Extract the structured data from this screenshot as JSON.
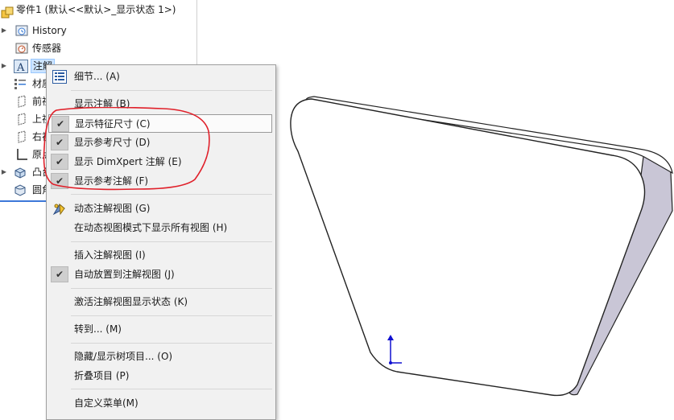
{
  "tree": {
    "root_label": "零件1 (默认<<默认>_显示状态 1>)",
    "items": [
      {
        "label": "History",
        "icon": "history-icon",
        "expandable": true
      },
      {
        "label": "传感器",
        "icon": "sensor-icon",
        "expandable": false
      },
      {
        "label": "注解",
        "icon": "annotation-icon",
        "expandable": true,
        "selected": true
      },
      {
        "label": "材质",
        "icon": "material-icon",
        "expandable": false
      },
      {
        "label": "前视",
        "icon": "plane-icon",
        "expandable": false
      },
      {
        "label": "上视",
        "icon": "plane-icon",
        "expandable": false
      },
      {
        "label": "右视",
        "icon": "plane-icon",
        "expandable": false
      },
      {
        "label": "原点",
        "icon": "origin-icon",
        "expandable": false
      },
      {
        "label": "凸台",
        "icon": "boss-extrude-icon",
        "expandable": true
      },
      {
        "label": "圆角",
        "icon": "fillet-icon",
        "expandable": false
      }
    ]
  },
  "menu": {
    "items": [
      {
        "label": "细节... (A)",
        "icon": "details-icon",
        "checked": false
      },
      {
        "label": "显示注解 (B)",
        "checked": false
      },
      {
        "label": "显示特征尺寸 (C)",
        "checked": true,
        "hover": true
      },
      {
        "label": "显示参考尺寸 (D)",
        "checked": true
      },
      {
        "label": "显示 DimXpert 注解 (E)",
        "checked": true
      },
      {
        "label": "显示参考注解 (F)",
        "checked": true
      },
      {
        "label": "动态注解视图 (G)",
        "icon": "dynamic-view-icon",
        "checked": false
      },
      {
        "label": "在动态视图模式下显示所有视图 (H)",
        "checked": false
      },
      {
        "label": "插入注解视图 (I)",
        "checked": false
      },
      {
        "label": "自动放置到注解视图 (J)",
        "checked": true
      },
      {
        "label": "激活注解视图显示状态 (K)",
        "checked": false
      },
      {
        "label": "转到... (M)",
        "checked": false
      },
      {
        "label": "隐藏/显示树项目... (O)",
        "checked": false
      },
      {
        "label": "折叠项目 (P)",
        "checked": false
      },
      {
        "label": "自定义菜单(M)",
        "checked": false
      }
    ],
    "check_glyph": "✔"
  },
  "colors": {
    "selection": "#cce4ff",
    "annotation_circle": "#e0202a",
    "axis_blue": "#1010d0",
    "part_edge": "#222222",
    "part_side": "#c9c6d6"
  }
}
